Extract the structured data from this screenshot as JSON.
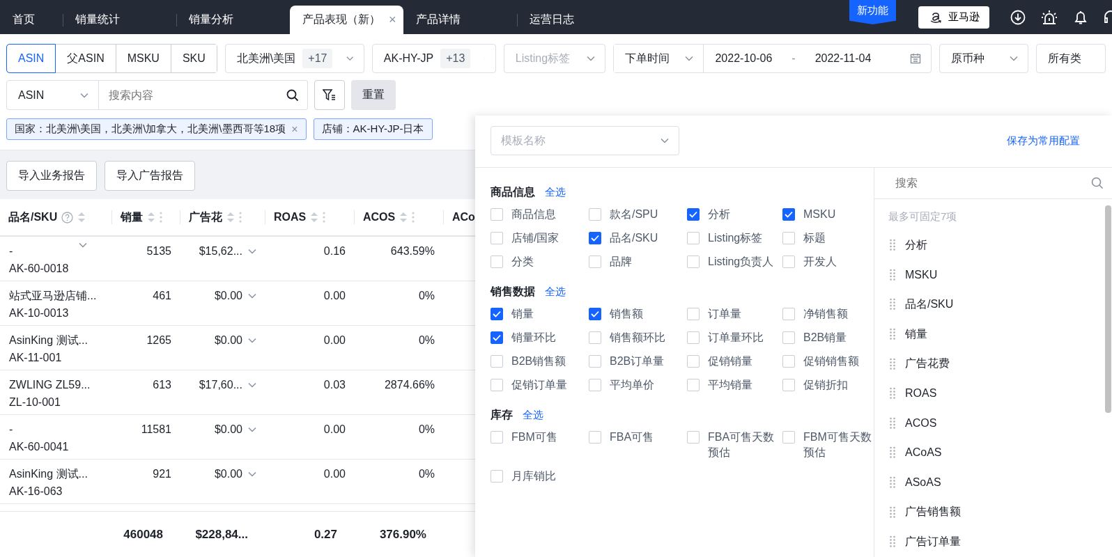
{
  "nav": {
    "tabs": [
      {
        "label": "首页",
        "selected": false
      },
      {
        "label": "销量统计",
        "selected": false
      },
      {
        "label": "销量分析",
        "selected": false
      },
      {
        "label": "产品表现（新）",
        "selected": true,
        "close": "×"
      },
      {
        "label": "产品详情",
        "selected": false
      },
      {
        "label": "运营日志",
        "selected": false
      }
    ],
    "badge": "新功能",
    "store_button": "亚马逊"
  },
  "filters": {
    "id_types": [
      {
        "label": "ASIN",
        "selected": true
      },
      {
        "label": "父ASIN",
        "selected": false
      },
      {
        "label": "MSKU",
        "selected": false
      },
      {
        "label": "SKU",
        "selected": false
      }
    ],
    "country": {
      "value": "北美洲\\美国",
      "more": "+17"
    },
    "store": {
      "value": "AK-HY-JP",
      "more": "+13"
    },
    "listing_tag": {
      "placeholder": "Listing标签"
    },
    "date_type": "下单时间",
    "date_start": "2022-10-06",
    "date_sep": "-",
    "date_end": "2022-11-04",
    "currency": "原币种",
    "category": "所有类"
  },
  "search": {
    "field_type": "ASIN",
    "placeholder": "搜索内容",
    "reset": "重置"
  },
  "tags": [
    {
      "text": "国家：北美洲\\美国，北美洲\\加拿大，北美洲\\墨西哥等18项",
      "close": "×"
    },
    {
      "text": "店铺：AK-HY-JP-日本"
    }
  ],
  "actions": [
    "导入业务报告",
    "导入广告报告"
  ],
  "table": {
    "columns": [
      {
        "label": "品名/SKU",
        "kind": "help"
      },
      {
        "label": "销量",
        "kind": "menu"
      },
      {
        "label": "广告花",
        "kind": "menu"
      },
      {
        "label": "ROAS",
        "kind": "menu"
      },
      {
        "label": "ACOS",
        "kind": "menu"
      },
      {
        "label": "ACo",
        "kind": "plain"
      }
    ],
    "rows": [
      {
        "name": "-",
        "sku": "AK-60-0018",
        "name_menu": true,
        "sales": "5135",
        "ad_spend": "$15,62...",
        "roas": "0.16",
        "acos": "643.59%"
      },
      {
        "name": "站式亚马逊店铺...",
        "sku": "AK-10-0013",
        "name_menu": false,
        "sales": "461",
        "ad_spend": "$0.00",
        "roas": "0.00",
        "acos": "0%"
      },
      {
        "name": "AsinKing 测试...",
        "sku": "AK-11-001",
        "name_menu": false,
        "sales": "1265",
        "ad_spend": "$0.00",
        "roas": "0.00",
        "acos": "0%"
      },
      {
        "name": "ZWLING ZL59...",
        "sku": "ZL-10-001",
        "name_menu": false,
        "sales": "613",
        "ad_spend": "$17,60...",
        "roas": "0.03",
        "acos": "2874.66%"
      },
      {
        "name": "-",
        "sku": "AK-60-0041",
        "name_menu": false,
        "sales": "11581",
        "ad_spend": "$0.00",
        "roas": "0.00",
        "acos": "0%"
      },
      {
        "name": "AsinKing 测试...",
        "sku": "AK-16-063",
        "name_menu": false,
        "sales": "921",
        "ad_spend": "$0.00",
        "roas": "0.00",
        "acos": "0%"
      }
    ],
    "totals": [
      "460048",
      "$228,84...",
      "0.27",
      "376.90%"
    ]
  },
  "panel": {
    "template_placeholder": "模板名称",
    "save_link": "保存为常用配置",
    "sections": [
      {
        "title": "商品信息",
        "select_all": "全选",
        "options": [
          {
            "label": "商品信息",
            "checked": false
          },
          {
            "label": "款名/SPU",
            "checked": false
          },
          {
            "label": "分析",
            "checked": true
          },
          {
            "label": "MSKU",
            "checked": true
          },
          {
            "label": "店铺/国家",
            "checked": false
          },
          {
            "label": "品名/SKU",
            "checked": true
          },
          {
            "label": "Listing标签",
            "checked": false
          },
          {
            "label": "标题",
            "checked": false
          },
          {
            "label": "分类",
            "checked": false
          },
          {
            "label": "品牌",
            "checked": false
          },
          {
            "label": "Listing负责人",
            "checked": false
          },
          {
            "label": "开发人",
            "checked": false
          }
        ]
      },
      {
        "title": "销售数据",
        "select_all": "全选",
        "options": [
          {
            "label": "销量",
            "checked": true
          },
          {
            "label": "销售额",
            "checked": true
          },
          {
            "label": "订单量",
            "checked": false
          },
          {
            "label": "净销售额",
            "checked": false
          },
          {
            "label": "销量环比",
            "checked": true
          },
          {
            "label": "销售额环比",
            "checked": false
          },
          {
            "label": "订单量环比",
            "checked": false
          },
          {
            "label": "B2B销量",
            "checked": false
          },
          {
            "label": "B2B销售额",
            "checked": false
          },
          {
            "label": "B2B订单量",
            "checked": false
          },
          {
            "label": "促销销量",
            "checked": false
          },
          {
            "label": "促销销售额",
            "checked": false
          },
          {
            "label": "促销订单量",
            "checked": false
          },
          {
            "label": "平均单价",
            "checked": false
          },
          {
            "label": "平均销量",
            "checked": false
          },
          {
            "label": "促销折扣",
            "checked": false
          }
        ]
      },
      {
        "title": "库存",
        "select_all": "全选",
        "options": [
          {
            "label": "FBM可售",
            "checked": false
          },
          {
            "label": "FBA可售",
            "checked": false
          },
          {
            "label": "FBA可售天数预估",
            "checked": false
          },
          {
            "label": "FBM可售天数预估",
            "checked": false
          },
          {
            "label": "月库销比",
            "checked": false
          }
        ]
      }
    ],
    "search_placeholder": "搜索",
    "hint": "最多可固定7项",
    "pinned": [
      "分析",
      "MSKU",
      "品名/SKU",
      "销量",
      "广告花费",
      "ROAS",
      "ACOS",
      "ACoAS",
      "ASoAS",
      "广告销售额",
      "广告订单量"
    ]
  }
}
